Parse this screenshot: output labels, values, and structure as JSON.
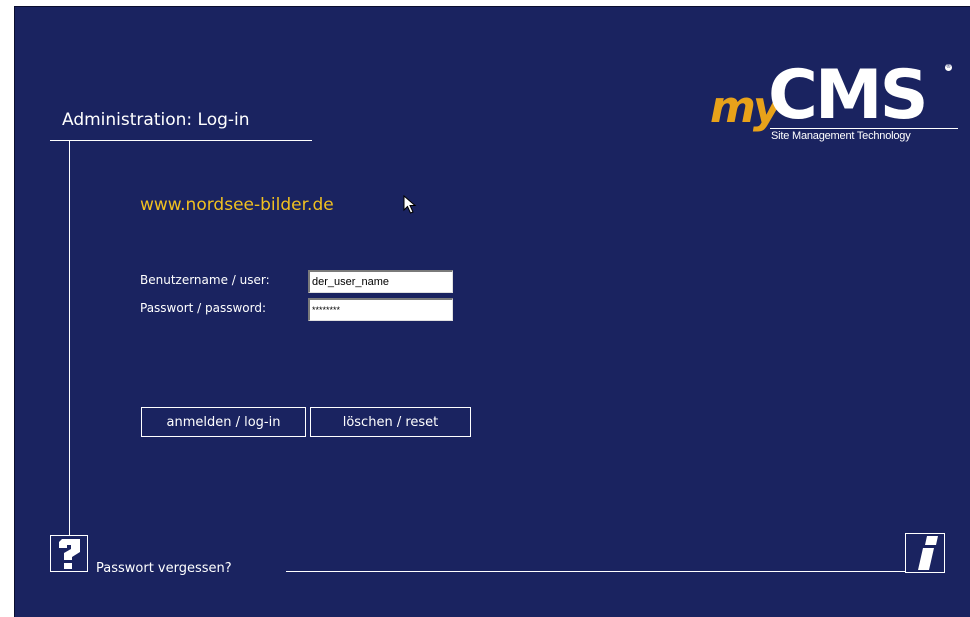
{
  "header": {
    "title": "Administration: Log-in"
  },
  "logo": {
    "my": "my",
    "cms": "CMS",
    "tagline": "Site Management Technology",
    "registered": "®"
  },
  "site": {
    "url": "www.nordsee-bilder.de"
  },
  "form": {
    "username_label": "Benutzername / user:",
    "username_value": "der_user_name",
    "password_label": "Passwort / password:",
    "password_value": "********"
  },
  "buttons": {
    "login_label": "anmelden / log-in",
    "reset_label": "löschen / reset"
  },
  "footer": {
    "forgot_password": "Passwort vergessen?"
  },
  "icons": {
    "help": "question-icon",
    "info": "info-icon",
    "cursor": "mouse-cursor-icon"
  },
  "colors": {
    "background": "#1a2360",
    "accent": "#f0c020",
    "logo_orange": "#e8a21a",
    "text": "#ffffff"
  }
}
